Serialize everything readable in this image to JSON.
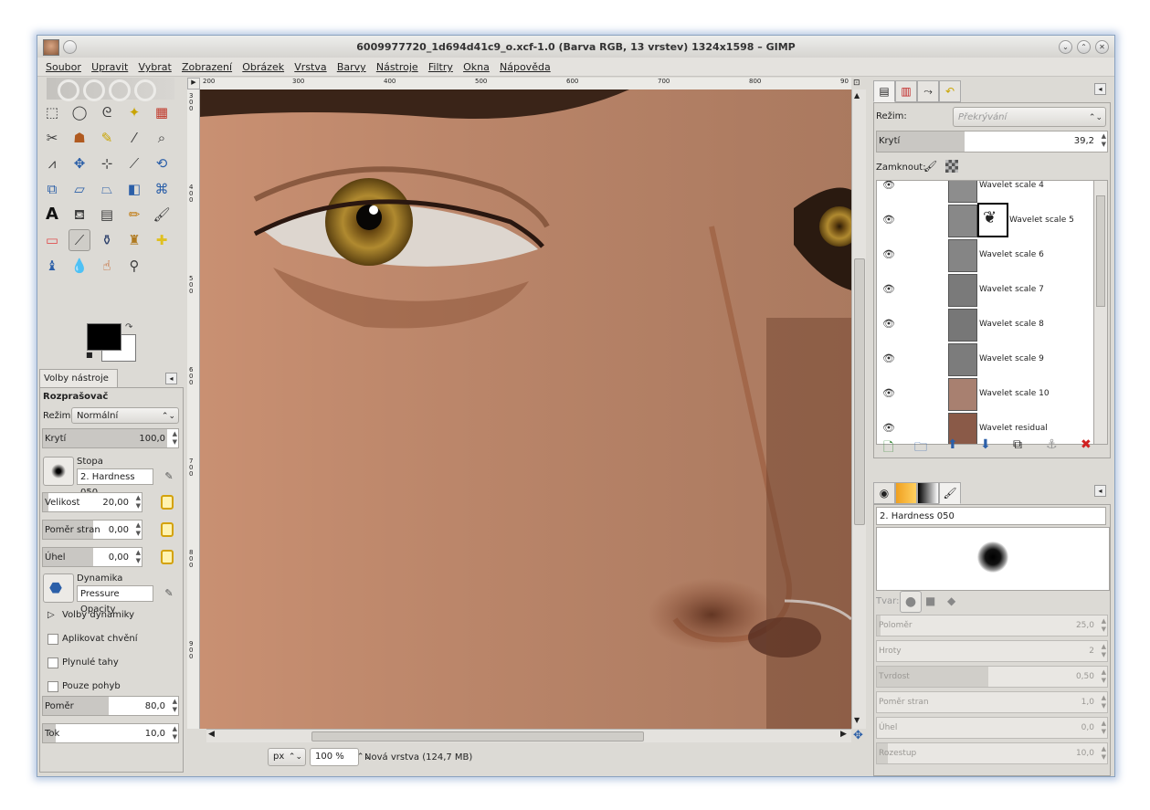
{
  "window": {
    "title": "6009977720_1d694d41c9_o.xcf-1.0 (Barva RGB, 13 vrstev) 1324x1598 – GIMP",
    "accent_color": "#8aa2bf"
  },
  "menu": [
    "Soubor",
    "Upravit",
    "Vybrat",
    "Zobrazení",
    "Obrázek",
    "Vrstva",
    "Barvy",
    "Nástroje",
    "Filtry",
    "Okna",
    "Nápověda"
  ],
  "toolbox": {
    "tools": [
      "rect-select-icon",
      "ellipse-select-icon",
      "lasso-icon",
      "fuzzy-select-icon",
      "select-by-color-icon",
      "scissors-icon",
      "foreground-select-icon",
      "paths-icon",
      "color-picker-icon",
      "zoom-icon",
      "measure-icon",
      "move-icon",
      "align-icon",
      "crop-icon",
      "rotate-icon",
      "scale-icon",
      "shear-icon",
      "perspective-icon",
      "flip-icon",
      "cage-icon",
      "text-icon",
      "bucket-fill-icon",
      "gradient-icon",
      "pencil-icon",
      "paintbrush-icon",
      "eraser-icon",
      "airbrush-icon",
      "ink-icon",
      "clone-icon",
      "heal-icon",
      "perspective-clone-icon",
      "blur-icon",
      "smudge-icon",
      "dodge-burn-icon"
    ],
    "fg_color": "#000000",
    "bg_color": "#ffffff"
  },
  "tool_options": {
    "tab_label": "Volby nástroje",
    "heading": "Rozprašovač",
    "mode_label": "Režim:",
    "mode_value": "Normální",
    "opacity_label": "Krytí",
    "opacity_value": "100,0",
    "brush_label": "Stopa",
    "brush_value": "2. Hardness 050",
    "size_label": "Velikost",
    "size_value": "20,00",
    "aspect_label": "Poměr stran",
    "aspect_value": "0,00",
    "angle_label": "Úhel",
    "angle_value": "0,00",
    "dynamics_label": "Dynamika",
    "dynamics_value": "Pressure Opacity",
    "dynamics_options": "Volby dynamiky",
    "jitter": "Aplikovat chvění",
    "smooth": "Plynulé tahy",
    "motion_only": "Pouze pohyb",
    "rate_label": "Poměr",
    "rate_value": "80,0",
    "flow_label": "Tok",
    "flow_value": "10,0"
  },
  "canvas": {
    "ruler_h": [
      "200",
      "300",
      "400",
      "500",
      "600",
      "700",
      "800",
      "90"
    ],
    "ruler_v": [
      "300",
      "400",
      "500",
      "600",
      "700",
      "800",
      "900",
      "1000",
      "1100"
    ],
    "unit": "px",
    "zoom": "100 %",
    "status": "Nová vrstva (124,7 MB)"
  },
  "layers_panel": {
    "mode_label": "Režim:",
    "mode_value": "Překrývání",
    "opacity_label": "Krytí",
    "opacity_value": "39,2",
    "lock_label": "Zamknout:",
    "layers": [
      {
        "name": "Wavelet scale 4",
        "thumb": "#8d8d8d"
      },
      {
        "name": "Wavelet scale 5",
        "thumb": "#888888"
      },
      {
        "name": "Wavelet scale 6",
        "thumb": "#858585"
      },
      {
        "name": "Wavelet scale 7",
        "thumb": "#7a7a7a"
      },
      {
        "name": "Wavelet scale 8",
        "thumb": "#777777"
      },
      {
        "name": "Wavelet scale 9",
        "thumb": "#7c7c7c"
      },
      {
        "name": "Wavelet scale 10",
        "thumb": "#a88070"
      },
      {
        "name": "Wavelet residual",
        "thumb": "#8a5a48"
      }
    ]
  },
  "brush_editor": {
    "name": "2. Hardness 050",
    "shape_label": "Tvar:",
    "radius_label": "Poloměr",
    "radius_value": "25,0",
    "spikes_label": "Hroty",
    "spikes_value": "2",
    "hardness_label": "Tvrdost",
    "hardness_value": "0,50",
    "aspect_label": "Poměr stran",
    "aspect_value": "1,0",
    "angle_label": "Úhel",
    "angle_value": "0,0",
    "spacing_label": "Rozestup",
    "spacing_value": "10,0"
  }
}
